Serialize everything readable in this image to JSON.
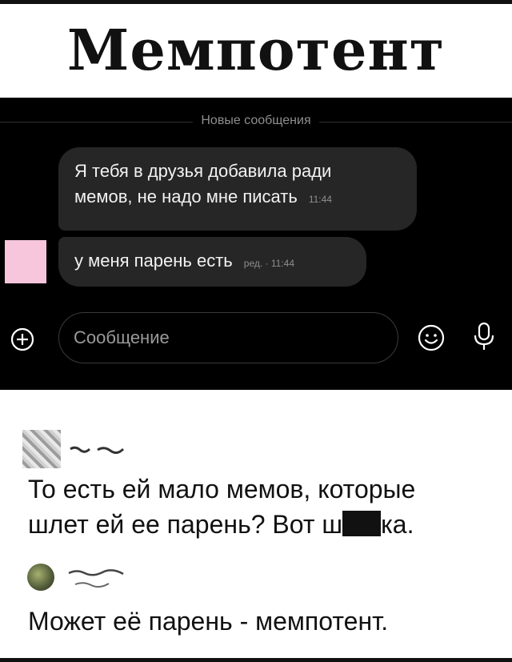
{
  "meme_title": "Мемпотент",
  "chat": {
    "divider_label": "Новые сообщения",
    "messages": [
      {
        "line1": "Я тебя в друзья добавила ради",
        "line2": "мемов, не надо мне писать",
        "time": "11:44"
      },
      {
        "text": "у меня парень есть",
        "time": "ред. · 11:44"
      }
    ],
    "composer": {
      "placeholder": "Сообщение",
      "icons": [
        "plus-circle-icon",
        "emoji-icon",
        "microphone-icon"
      ]
    }
  },
  "comments": [
    {
      "line1": "То есть ей мало мемов, которые",
      "line2_before": "шлет ей ее парень? Вот ш",
      "line2_after": "ка."
    },
    {
      "text": "Может её парень - мемпотент."
    }
  ]
}
